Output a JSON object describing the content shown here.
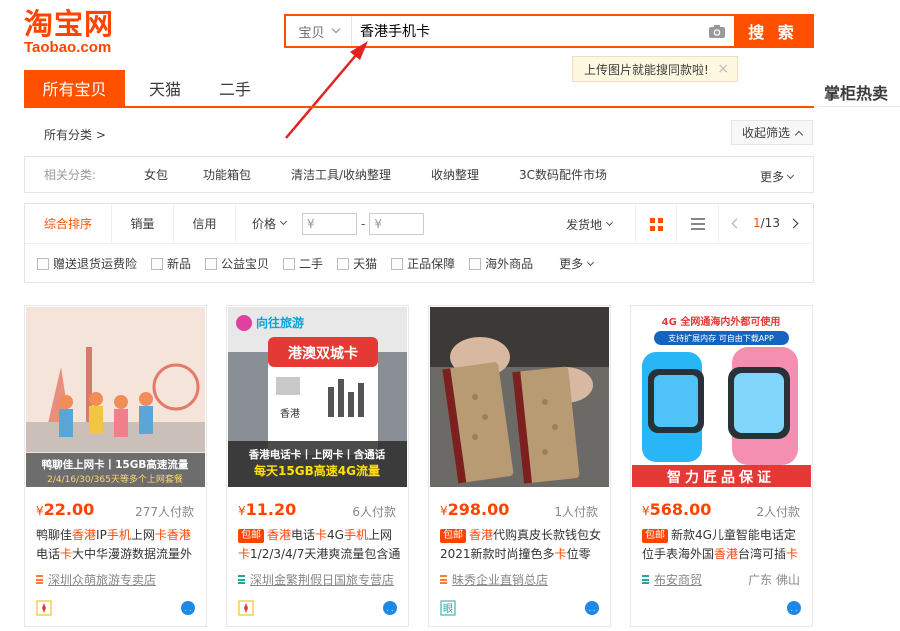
{
  "logo": {
    "cn": "淘宝网",
    "en": "Taobao.com"
  },
  "search": {
    "type_label": "宝贝",
    "query": "香港手机卡",
    "button": "搜 索",
    "tip": "上传图片就能搜同款啦!",
    "tip_close": "×"
  },
  "tabs": [
    "所有宝贝",
    "天猫",
    "二手"
  ],
  "side_title": "掌柜热卖",
  "breadcrumb": "所有分类 >",
  "collapse": "收起筛选",
  "related": {
    "label": "相关分类:",
    "items": [
      "女包",
      "功能箱包",
      "清洁工具/收纳整理",
      "收纳整理",
      "3C数码配件市场"
    ],
    "more": "更多"
  },
  "sort": {
    "items": [
      "综合排序",
      "销量",
      "信用",
      "价格"
    ],
    "price_min_placeholder": "¥",
    "price_max_placeholder": "¥",
    "dash": "-",
    "ship_from": "发货地",
    "page_current": "1",
    "page_total": "/13"
  },
  "filters": [
    "赠送退货运费险",
    "新品",
    "公益宝贝",
    "二手",
    "天猫",
    "正品保障",
    "海外商品"
  ],
  "filters_more": "更多",
  "products": [
    {
      "price": "22.00",
      "sold": "277人付款",
      "title_parts": [
        "鸭聊佳",
        "香港",
        "IP",
        "手机",
        "上网",
        "卡",
        "香港",
        "电话",
        "卡",
        "大中华漫游数据流量外"
      ],
      "title_hl": [
        false,
        true,
        false,
        true,
        false,
        true,
        true,
        false,
        true,
        false
      ],
      "tag": "",
      "shop": "深圳众萌旅游专卖店",
      "location": "",
      "banner1": "鸭聊佳上网卡丨15GB高速流量",
      "banner2": "2/4/16/30/365天等多个上网套餐"
    },
    {
      "price": "11.20",
      "sold": "6人付款",
      "title_parts": [
        "香港",
        "电话",
        "卡",
        "4G",
        "手机",
        "上网",
        "卡",
        "1/2/3/4/7天港爽流量包含通"
      ],
      "title_hl": [
        true,
        false,
        true,
        false,
        true,
        false,
        true,
        false
      ],
      "tag": "包邮",
      "shop": "深圳金繁荆假日国旅专营店",
      "location": "",
      "brand": "向往旅游",
      "card_title": "港澳双城卡",
      "banner1": "香港电话卡丨上网卡丨含通话",
      "banner2": "每天15GB高速4G流量",
      "region": "香港"
    },
    {
      "price": "298.00",
      "sold": "1人付款",
      "title_parts": [
        "香港",
        "代购真皮长款钱包女2021新款时尚撞色多",
        "卡",
        "位零"
      ],
      "title_hl": [
        true,
        false,
        true,
        false
      ],
      "tag": "包邮",
      "shop": "昧秀企业直销总店",
      "location": ""
    },
    {
      "price": "568.00",
      "sold": "2人付款",
      "title_parts": [
        "新款4G儿童智能电话定位手表海外国",
        "香港",
        "台湾可插",
        "卡"
      ],
      "title_hl": [
        false,
        true,
        false,
        true
      ],
      "tag": "包邮",
      "shop": "布安商贸",
      "location": "广东 佛山",
      "top1": "4G 全网通海内外都可使用",
      "top2": "支持扩展内存 可自由下载APP",
      "banner": "智力匠品保证"
    }
  ],
  "currency": "¥",
  "colors": {
    "accent": "#ff5000",
    "price": "#ff4400",
    "tip_bg": "#fff8e1"
  }
}
